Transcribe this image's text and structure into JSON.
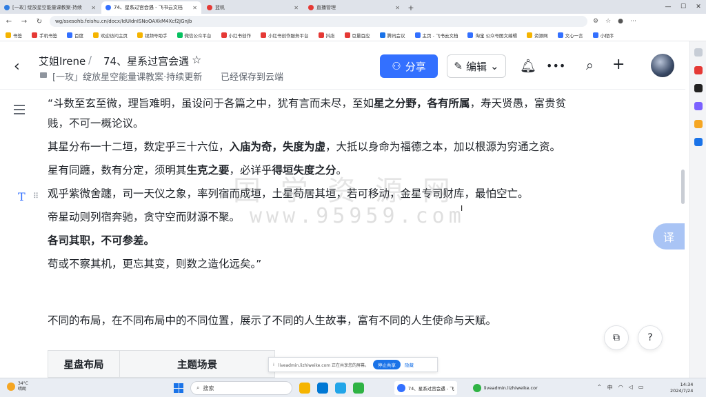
{
  "browser": {
    "tabs": [
      {
        "title": "[一玫] 绽放星空能量课教案·持续",
        "color": "#2f7de1",
        "active": false
      },
      {
        "title": "74、星系过宫会遇 - 飞书云文档",
        "color": "#3370ff",
        "active": true
      },
      {
        "title": "蓝帆",
        "color": "#e53935",
        "active": false
      },
      {
        "title": "直播管理",
        "color": "#e53935",
        "active": false
      }
    ],
    "new_tab": "+",
    "url": "wg/ssesohb.feishu.cn/docx/IdUIdnISNoOAXkM4Xcf2JGnJb",
    "bookmarks": [
      {
        "label": "书签",
        "color": "#f5b400"
      },
      {
        "label": "手机书签",
        "color": "#e53935"
      },
      {
        "label": "百度",
        "color": "#3370ff"
      },
      {
        "label": "欢迎访问主页",
        "color": "#f5b400"
      },
      {
        "label": "视频号助手",
        "color": "#f5b400"
      },
      {
        "label": "微信公众平台",
        "color": "#07c160"
      },
      {
        "label": "小红书创作",
        "color": "#e53935"
      },
      {
        "label": "小红书创作服务平台",
        "color": "#e53935"
      },
      {
        "label": "抖店",
        "color": "#e53935"
      },
      {
        "label": "巨量百应",
        "color": "#e53935"
      },
      {
        "label": "腾讯会议",
        "color": "#1a73e8"
      },
      {
        "label": "主页 - 飞书云文档",
        "color": "#3370ff"
      },
      {
        "label": "淘宝 公众号图文编辑",
        "color": "#3370ff"
      },
      {
        "label": "资源网",
        "color": "#f5b400"
      },
      {
        "label": "文心一言",
        "color": "#3370ff"
      },
      {
        "label": "小程序",
        "color": "#3370ff"
      }
    ]
  },
  "header": {
    "author": "艾姐Irene",
    "separator": "/",
    "title": "74、星系过宫会遇",
    "breadcrumb": "[一玫」绽放星空能量课教案·持续更新",
    "saved": "已经保存到云端",
    "share_label": "分享",
    "edit_label": "编辑"
  },
  "document": {
    "lines": [
      {
        "segments": [
          {
            "t": "“斗数至玄至微，理旨难明，虽设问于各篇之中，犹有言而未尽，至如",
            "b": false
          },
          {
            "t": "星之分野，各有所属",
            "b": true
          },
          {
            "t": "，寿天贤愚，富贵贫",
            "b": false
          }
        ],
        "tight": true
      },
      {
        "segments": [
          {
            "t": "贱，不可一概论议。",
            "b": false
          }
        ],
        "tight": false
      },
      {
        "segments": [
          {
            "t": "其星分布一十二垣，数定乎三十六位，",
            "b": false
          },
          {
            "t": "入庙为奇，失度为虚",
            "b": true
          },
          {
            "t": "，大抵以身命为福德之本，加以根源为穷通之资。",
            "b": false
          }
        ],
        "tight": false
      },
      {
        "segments": [
          {
            "t": "星有同躔，数有分定，须明其",
            "b": false
          },
          {
            "t": "生克之要",
            "b": true
          },
          {
            "t": "，必详乎",
            "b": false
          },
          {
            "t": "得垣失度之分",
            "b": true
          },
          {
            "t": "。",
            "b": false
          }
        ],
        "tight": false
      },
      {
        "segments": [
          {
            "t": "观乎紫微舍躔，司一天仪之象，率列宿而成垣，土星苟居其垣，若可移动，金星专司财库，最怕空亡。",
            "b": false
          }
        ],
        "tight": false
      },
      {
        "segments": [
          {
            "t": "帝星动则列宿奔驰，贪守空而财源不聚。",
            "b": false
          }
        ],
        "tight": false
      },
      {
        "segments": [
          {
            "t": "各司其职，不可参差。",
            "b": true
          }
        ],
        "tight": false
      },
      {
        "segments": [
          {
            "t": "苟或不察其机，更忘其变，则数之造化远矣。”",
            "b": false
          }
        ],
        "tight": false
      }
    ],
    "summary": "不同的布局，在不同布局中的不同位置，展示了不同的人生故事，富有不同的人生使命与天赋。",
    "table_headers": [
      "星盘布局",
      "主题场景"
    ]
  },
  "watermark": {
    "line1": "国 学 资 源 网",
    "line2": "www.95959.com"
  },
  "translate_label": "译",
  "help_label": "?",
  "share_notice": {
    "text": "liveadmin.lizhiweike.com 正在共享您的屏幕。",
    "stop": "停止共享",
    "hide": "隐藏"
  },
  "taskbar": {
    "weather_temp": "34°C",
    "weather_desc": "晴朗",
    "search_placeholder": "搜索",
    "app1": "74、星系过宫会遇 - 飞",
    "app2": "liveadmin.lizhiweike.cor",
    "tray_lang": "中",
    "time": "14:34",
    "date": "2024/7/24"
  }
}
